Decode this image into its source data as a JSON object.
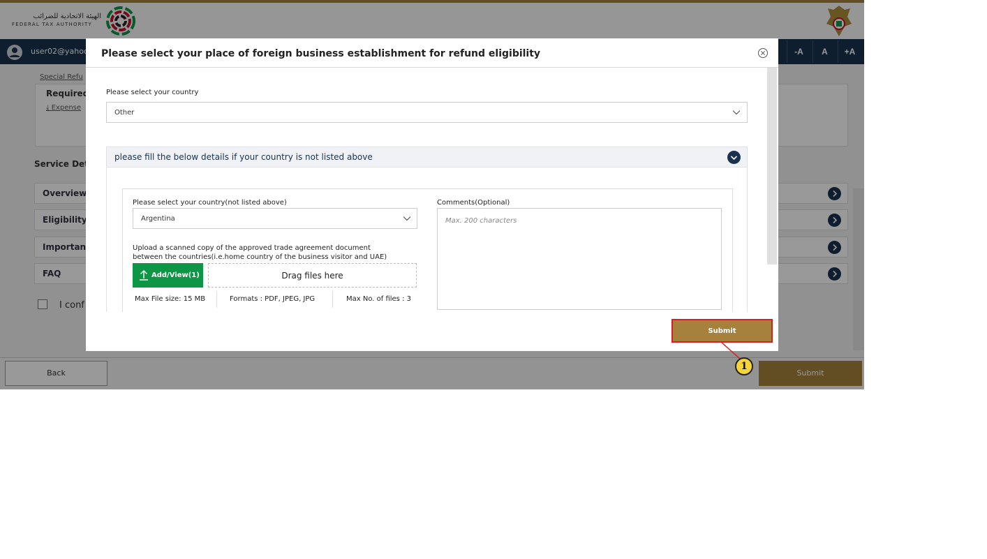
{
  "header": {
    "logo_arabic": "الهيئة الاتحادية للضرائب",
    "logo_english": "FEDERAL TAX AUTHORITY"
  },
  "navbar": {
    "user_email": "user02@yahoo",
    "font_decrease": "-A",
    "font_reset": "A",
    "font_increase": "+A"
  },
  "background": {
    "breadcrumb": "Special Refu",
    "required_title": "Required",
    "required_link": "Expense",
    "service_details_title": "Service Det",
    "accordion": [
      "Overview",
      "Eligibility",
      "Important",
      "FAQ"
    ],
    "confirm_text": "I conf"
  },
  "footer": {
    "back_label": "Back",
    "submit_label": "Submit"
  },
  "modal": {
    "title": "Please select your place of foreign business establishment for refund eligibility",
    "country_label": "Please select your country",
    "country_value": "Other",
    "section_title": "please fill the below details if your country is not listed above",
    "unlisted_country_label": "Please select your country(not listed above)",
    "unlisted_country_value": "Argentina",
    "upload_line1": "Upload a scanned copy of the approved trade agreement document",
    "upload_line2": "between the countries(i.e.home country of the business visitor and UAE)",
    "add_view_label": "Add/View(1)",
    "drag_label": "Drag files here",
    "max_file_size": "Max File size: 15 MB",
    "formats": "Formats : PDF, JPEG, JPG",
    "max_files": "Max No. of files : 3",
    "comments_label": "Comments(Optional)",
    "comments_placeholder": "Max. 200 characters",
    "submit_label": "Submit"
  },
  "annotation": {
    "step_number": "1"
  },
  "colors": {
    "brand_gold": "#a5813b",
    "nav_blue": "#18324f",
    "upload_green": "#0d9645",
    "highlight_red": "#d32020",
    "callout_yellow": "#f7d53a"
  }
}
